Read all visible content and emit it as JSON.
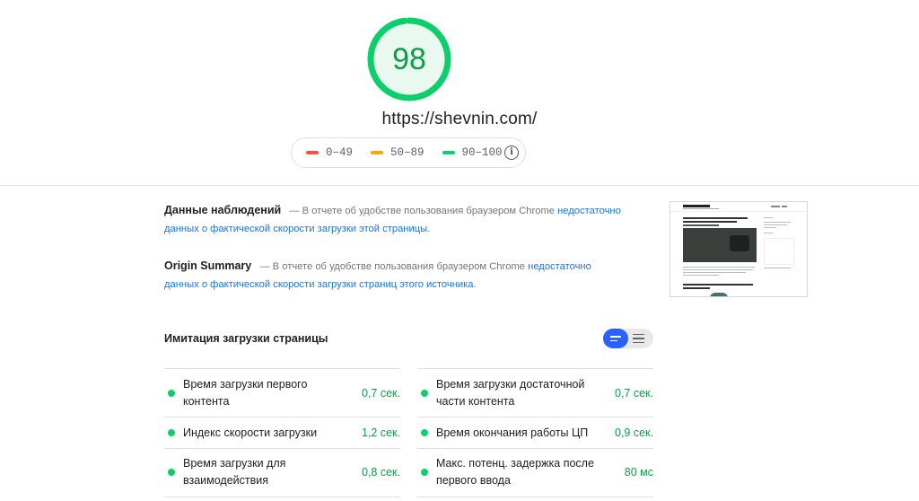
{
  "score": {
    "value": "98",
    "fraction": 0.98,
    "color": "#0cce6b"
  },
  "url": "https://shevnin.com/",
  "legend": {
    "items": [
      {
        "label": "0–49",
        "color": "#ff4e42"
      },
      {
        "label": "50–89",
        "color": "#ffa400"
      },
      {
        "label": "90–100",
        "color": "#0cce6b"
      }
    ],
    "info_icon": "info-icon"
  },
  "field_data": {
    "title": "Данные наблюдений",
    "text": "— В отчете об удобстве пользования браузером Chrome",
    "link": "недостаточно данных о фактической скорости загрузки этой страницы",
    "end": "."
  },
  "origin_summary": {
    "title": "Origin Summary",
    "text": "— В отчете об удобстве пользования браузером Chrome",
    "link": "недостаточно данных о фактической скорости загрузки страниц этого источника",
    "end": "."
  },
  "lab": {
    "title": "Имитация загрузки страницы",
    "metrics": [
      {
        "label": "Время загрузки первого контента",
        "value": "0,7 сек."
      },
      {
        "label": "Время загрузки достаточной части контента",
        "value": "0,7 сек."
      },
      {
        "label": "Индекс скорости загрузки",
        "value": "1,2 сек."
      },
      {
        "label": "Время окончания работы ЦП",
        "value": "0,9 сек."
      },
      {
        "label": "Время загрузки для взаимодействия",
        "value": "0,8 сек."
      },
      {
        "label": "Макс. потенц. задержка после первого ввода",
        "value": "80 мс"
      }
    ]
  },
  "colors": {
    "pass": "#0cce6b",
    "pass_text": "#0c9d4a",
    "link": "#1a73e8",
    "toggle_active": "#2962ff"
  }
}
